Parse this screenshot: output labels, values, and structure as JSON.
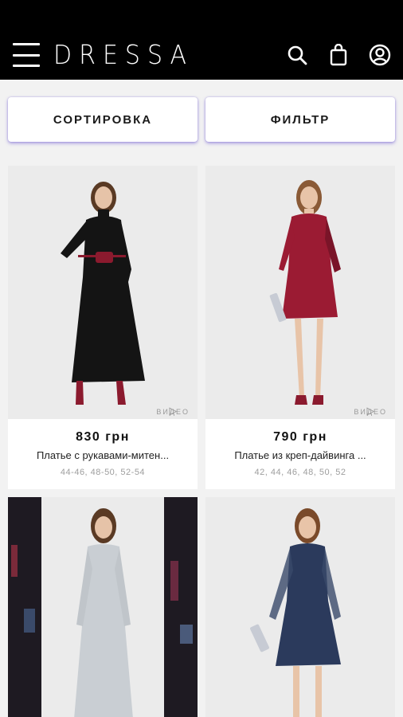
{
  "app": {
    "logo": "DRESSA"
  },
  "header_icons": [
    "menu-icon",
    "search-icon",
    "bag-icon",
    "account-icon"
  ],
  "toolbar": {
    "sort_label": "СОРТИРОВКА",
    "filter_label": "ФИЛЬТР"
  },
  "products": [
    {
      "price": "830 грн",
      "name": "Платье с рукавами-митен...",
      "sizes": "44-46, 48-50, 52-54",
      "video_label": "ВИДЕО",
      "dress_color": "#141414"
    },
    {
      "price": "790 грн",
      "name": "Платье из креп-дайвинга ...",
      "sizes": "42, 44, 46, 48, 50, 52",
      "video_label": "ВИДЕО",
      "dress_color": "#9b1b33"
    },
    {
      "dress_color": "#c9ced3"
    },
    {
      "dress_color": "#2b3a5c"
    }
  ],
  "colors": {
    "appbar": "#000000",
    "accent_shadow": "#6e5ad2",
    "background": "#f2f2f2"
  }
}
